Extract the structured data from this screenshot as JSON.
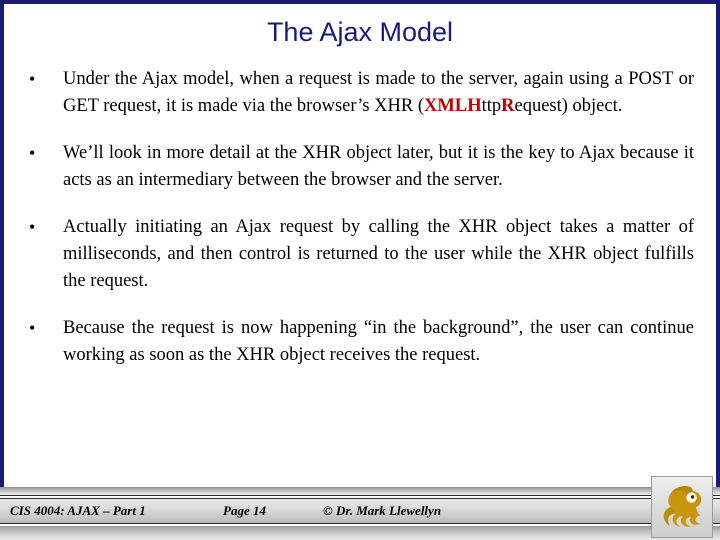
{
  "slide": {
    "title": "The Ajax Model",
    "title_color": "#1a1a7a",
    "border_color": "#1a1a7a",
    "highlight_color": "#c00000",
    "bullet_glyph": "•",
    "bullets": [
      {
        "id": "bullet-ajax-model-request",
        "parts": [
          {
            "text": "Under the Ajax model, when a request is made to the server, again using a POST or GET request, it is made via the browser’s XHR (",
            "style": "normal"
          },
          {
            "text": "XML",
            "style": "highlight"
          },
          {
            "text": "H",
            "style": "highlight"
          },
          {
            "text": "ttp",
            "style": "normal"
          },
          {
            "text": "R",
            "style": "highlight"
          },
          {
            "text": "equest) object.",
            "style": "normal"
          }
        ],
        "plain": "Under the Ajax model, when a request is made to the server, again using a POST or GET request, it is made via the browser’s XHR (XMLHttpRequest) object."
      },
      {
        "id": "bullet-xhr-intermediary",
        "parts": [
          {
            "text": "We’ll look in more detail at the XHR object later, but it is the key to Ajax because it acts as an intermediary between the browser and the server.",
            "style": "normal"
          }
        ],
        "plain": "We’ll look in more detail at the XHR object later, but it is the key to Ajax because it acts as an intermediary between the browser and the server."
      },
      {
        "id": "bullet-milliseconds",
        "parts": [
          {
            "text": "Actually initiating an Ajax request by calling the XHR object takes a matter of milliseconds, and then control is returned to the user while the XHR object fulfills the request.",
            "style": "normal"
          }
        ],
        "plain": "Actually initiating an Ajax request by calling the XHR object takes a matter of milliseconds, and then control is returned to the user while the XHR object fulfills the request."
      },
      {
        "id": "bullet-background",
        "parts": [
          {
            "text": "Because the request is now happening “in the background”, the user can continue working as soon as the XHR object receives the request.",
            "style": "normal"
          }
        ],
        "plain": "Because the request is now happening “in the background”, the user can continue working as soon as the XHR object receives the request."
      }
    ]
  },
  "footer": {
    "course": "CIS 4004: AJAX – Part 1",
    "page": "Page 14",
    "credit": "© Dr. Mark Llewellyn",
    "logo": {
      "name": "ucf-pegasus-logo",
      "color": "#c8960c",
      "shade_color": "#a87c06"
    }
  }
}
